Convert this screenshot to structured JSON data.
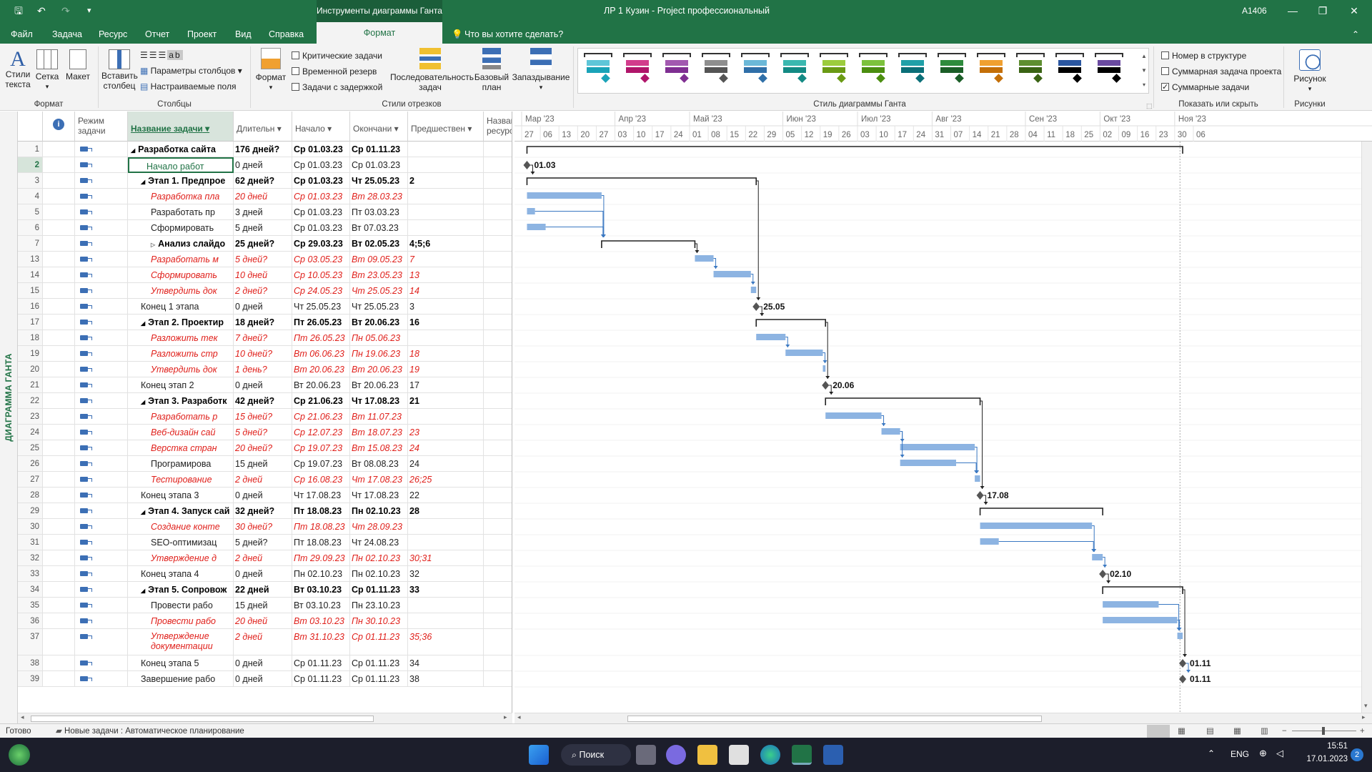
{
  "window": {
    "tools_tab": "Инструменты диаграммы Ганта",
    "title": "ЛР 1 Кузин  -  Project профессиональный",
    "user": "A1406"
  },
  "tabs": [
    {
      "id": "file",
      "label": "Файл"
    },
    {
      "id": "task",
      "label": "Задача"
    },
    {
      "id": "resource",
      "label": "Ресурс"
    },
    {
      "id": "report",
      "label": "Отчет"
    },
    {
      "id": "project",
      "label": "Проект"
    },
    {
      "id": "view",
      "label": "Вид"
    },
    {
      "id": "help",
      "label": "Справка"
    },
    {
      "id": "format",
      "label": "Формат"
    }
  ],
  "search_label": "Что вы хотите сделать?",
  "ribbon": {
    "text_styles": "Стили\nтекста",
    "gridlines": "Сетка",
    "layout": "Макет",
    "group_format": "Формат",
    "insert_column": "Вставить\nстолбец",
    "column_settings": "Параметры столбцов",
    "custom_fields": "Настраиваемые поля",
    "group_columns": "Столбцы",
    "format_btn": "Формат",
    "critical_tasks": "Критические задачи",
    "slack": "Временной резерв",
    "late_tasks": "Задачи с задержкой",
    "task_path": "Последовательность\nзадач",
    "baseline": "Базовый\nплан",
    "slippage": "Запаздывание",
    "group_bar_styles": "Стили отрезков",
    "group_gantt_style": "Стиль диаграммы Ганта",
    "outline_number": "Номер в структуре",
    "project_summary": "Суммарная задача проекта",
    "summary_tasks": "Суммарные задачи",
    "group_show_hide": "Показать или скрыть",
    "drawing": "Рисунок",
    "group_drawings": "Рисунки"
  },
  "gantt_styles": [
    {
      "c": "#5ec6d8",
      "k": "#1aa3b8"
    },
    {
      "c": "#d23c8c",
      "k": "#b0156a"
    },
    {
      "c": "#a259b0",
      "k": "#7f2f92"
    },
    {
      "c": "#8e8e8e",
      "k": "#555555"
    },
    {
      "c": "#6bb8d8",
      "k": "#2f6fa8"
    },
    {
      "c": "#3ab8b0",
      "k": "#138a84"
    },
    {
      "c": "#9ccc3c",
      "k": "#6a9a14"
    },
    {
      "c": "#7cc23c",
      "k": "#4b8e10"
    },
    {
      "c": "#1fa0a8",
      "k": "#0b6f78"
    },
    {
      "c": "#2e8b3c",
      "k": "#1b5e27"
    },
    {
      "c": "#f0a030",
      "k": "#c46f08"
    },
    {
      "c": "#5e8e30",
      "k": "#3a6314"
    },
    {
      "c": "#2a56a0",
      "k": "#000000"
    },
    {
      "c": "#6a4aa0",
      "k": "#000000"
    }
  ],
  "side_label": "ДИАГРАММА ГАНТА",
  "columns": {
    "mode": "Режим\nзадачи",
    "name": "Название задачи",
    "duration": "Длительн",
    "start": "Начало",
    "finish": "Окончани",
    "pred": "Предшествен",
    "res": "Названия\nресурсов"
  },
  "rows": [
    {
      "id": "1",
      "name": "Разработка сайта",
      "dur": "176 дней?",
      "start": "Ср 01.03.23",
      "fin": "Ср 01.11.23",
      "pred": "",
      "t": "sum0",
      "indent": 0
    },
    {
      "id": "2",
      "name": "Начало работ",
      "dur": "0 дней",
      "start": "Ср 01.03.23",
      "fin": "Ср 01.03.23",
      "pred": "",
      "t": "sel",
      "indent": 1
    },
    {
      "id": "3",
      "name": "Этап 1. Предпрое",
      "dur": "62 дней?",
      "start": "Ср 01.03.23",
      "fin": "Чт 25.05.23",
      "pred": "2",
      "t": "sum",
      "indent": 1
    },
    {
      "id": "4",
      "name": "Разработка пла",
      "dur": "20 дней",
      "start": "Ср 01.03.23",
      "fin": "Вт 28.03.23",
      "pred": "",
      "t": "crit",
      "indent": 2
    },
    {
      "id": "5",
      "name": "Разработать пр",
      "dur": "3 дней",
      "start": "Ср 01.03.23",
      "fin": "Пт 03.03.23",
      "pred": "",
      "t": "n",
      "indent": 2
    },
    {
      "id": "6",
      "name": "Сформировать",
      "dur": "5 дней",
      "start": "Ср 01.03.23",
      "fin": "Вт 07.03.23",
      "pred": "",
      "t": "n",
      "indent": 2
    },
    {
      "id": "7",
      "name": "Анализ слайдо",
      "dur": "25 дней?",
      "start": "Ср 29.03.23",
      "fin": "Вт 02.05.23",
      "pred": "4;5;6",
      "t": "sumc",
      "indent": 2
    },
    {
      "id": "13",
      "name": "Разработать м",
      "dur": "5 дней?",
      "start": "Ср 03.05.23",
      "fin": "Вт 09.05.23",
      "pred": "7",
      "t": "crit",
      "indent": 2
    },
    {
      "id": "14",
      "name": "Сформировать",
      "dur": "10 дней",
      "start": "Ср 10.05.23",
      "fin": "Вт 23.05.23",
      "pred": "13",
      "t": "crit",
      "indent": 2
    },
    {
      "id": "15",
      "name": "Утвердить док",
      "dur": "2 дней?",
      "start": "Ср 24.05.23",
      "fin": "Чт 25.05.23",
      "pred": "14",
      "t": "crit",
      "indent": 2
    },
    {
      "id": "16",
      "name": "Конец 1 этапа",
      "dur": "0 дней",
      "start": "Чт 25.05.23",
      "fin": "Чт 25.05.23",
      "pred": "3",
      "t": "n",
      "indent": 1
    },
    {
      "id": "17",
      "name": "Этап 2. Проектир",
      "dur": "18 дней?",
      "start": "Пт 26.05.23",
      "fin": "Вт 20.06.23",
      "pred": "16",
      "t": "sum",
      "indent": 1
    },
    {
      "id": "18",
      "name": "Разложить тек",
      "dur": "7 дней?",
      "start": "Пт 26.05.23",
      "fin": "Пн 05.06.23",
      "pred": "",
      "t": "crit",
      "indent": 2
    },
    {
      "id": "19",
      "name": "Разложить стр",
      "dur": "10 дней?",
      "start": "Вт 06.06.23",
      "fin": "Пн 19.06.23",
      "pred": "18",
      "t": "crit",
      "indent": 2
    },
    {
      "id": "20",
      "name": "Утвердить док",
      "dur": "1 день?",
      "start": "Вт 20.06.23",
      "fin": "Вт 20.06.23",
      "pred": "19",
      "t": "crit",
      "indent": 2
    },
    {
      "id": "21",
      "name": "Конец этап 2",
      "dur": "0 дней",
      "start": "Вт 20.06.23",
      "fin": "Вт 20.06.23",
      "pred": "17",
      "t": "n",
      "indent": 1
    },
    {
      "id": "22",
      "name": "Этап 3. Разработк",
      "dur": "42 дней?",
      "start": "Ср 21.06.23",
      "fin": "Чт 17.08.23",
      "pred": "21",
      "t": "sum",
      "indent": 1
    },
    {
      "id": "23",
      "name": "Разработать р",
      "dur": "15 дней?",
      "start": "Ср 21.06.23",
      "fin": "Вт 11.07.23",
      "pred": "",
      "t": "crit",
      "indent": 2
    },
    {
      "id": "24",
      "name": "Веб-дизайн сай",
      "dur": "5 дней?",
      "start": "Ср 12.07.23",
      "fin": "Вт 18.07.23",
      "pred": "23",
      "t": "crit",
      "indent": 2
    },
    {
      "id": "25",
      "name": "Верстка стран",
      "dur": "20 дней?",
      "start": "Ср 19.07.23",
      "fin": "Вт 15.08.23",
      "pred": "24",
      "t": "crit",
      "indent": 2
    },
    {
      "id": "26",
      "name": "Програмирова",
      "dur": "15 дней",
      "start": "Ср 19.07.23",
      "fin": "Вт 08.08.23",
      "pred": "24",
      "t": "n",
      "indent": 2
    },
    {
      "id": "27",
      "name": "Тестирование",
      "dur": "2 дней",
      "start": "Ср 16.08.23",
      "fin": "Чт 17.08.23",
      "pred": "26;25",
      "t": "crit",
      "indent": 2
    },
    {
      "id": "28",
      "name": "Конец этапа 3",
      "dur": "0 дней",
      "start": "Чт 17.08.23",
      "fin": "Чт 17.08.23",
      "pred": "22",
      "t": "n",
      "indent": 1
    },
    {
      "id": "29",
      "name": "Этап 4. Запуск сай",
      "dur": "32 дней?",
      "start": "Пт 18.08.23",
      "fin": "Пн 02.10.23",
      "pred": "28",
      "t": "sum",
      "indent": 1
    },
    {
      "id": "30",
      "name": "Создание конте",
      "dur": "30 дней?",
      "start": "Пт 18.08.23",
      "fin": "Чт 28.09.23",
      "pred": "",
      "t": "crit",
      "indent": 2
    },
    {
      "id": "31",
      "name": "SEO-оптимизац",
      "dur": "5 дней?",
      "start": "Пт 18.08.23",
      "fin": "Чт 24.08.23",
      "pred": "",
      "t": "n",
      "indent": 2
    },
    {
      "id": "32",
      "name": "Утверждение д",
      "dur": "2 дней",
      "start": "Пт 29.09.23",
      "fin": "Пн 02.10.23",
      "pred": "30;31",
      "t": "crit",
      "indent": 2
    },
    {
      "id": "33",
      "name": "Конец этапа 4",
      "dur": "0 дней",
      "start": "Пн 02.10.23",
      "fin": "Пн 02.10.23",
      "pred": "32",
      "t": "n",
      "indent": 1
    },
    {
      "id": "34",
      "name": "Этап 5. Сопровож",
      "dur": "22 дней",
      "start": "Вт 03.10.23",
      "fin": "Ср 01.11.23",
      "pred": "33",
      "t": "sum",
      "indent": 1
    },
    {
      "id": "35",
      "name": "Провести рабо",
      "dur": "15 дней",
      "start": "Вт 03.10.23",
      "fin": "Пн 23.10.23",
      "pred": "",
      "t": "n",
      "indent": 2
    },
    {
      "id": "36",
      "name": "Провести рабо",
      "dur": "20 дней",
      "start": "Вт 03.10.23",
      "fin": "Пн 30.10.23",
      "pred": "",
      "t": "crit",
      "indent": 2
    },
    {
      "id": "37",
      "name": "Утверждение\nдокументации",
      "dur": "2 дней",
      "start": "Вт 31.10.23",
      "fin": "Ср 01.11.23",
      "pred": "35;36",
      "t": "crit",
      "indent": 2,
      "tall": true
    },
    {
      "id": "38",
      "name": "Конец этапа 5",
      "dur": "0 дней",
      "start": "Ср 01.11.23",
      "fin": "Ср 01.11.23",
      "pred": "34",
      "t": "n",
      "indent": 1
    },
    {
      "id": "39",
      "name": "Завершение рабо",
      "dur": "0 дней",
      "start": "Ср 01.11.23",
      "fin": "Ср 01.11.23",
      "pred": "38",
      "t": "n",
      "indent": 1
    }
  ],
  "timescale": {
    "months": [
      {
        "label": "Мар '23",
        "start": "2023-02-27"
      },
      {
        "label": "Апр '23",
        "start": "2023-04-03"
      },
      {
        "label": "Май '23",
        "start": "2023-05-01"
      },
      {
        "label": "Июн '23",
        "start": "2023-06-05"
      },
      {
        "label": "Июл '23",
        "start": "2023-07-03"
      },
      {
        "label": "Авг '23",
        "start": "2023-07-31"
      },
      {
        "label": "Сен '23",
        "start": "2023-09-04"
      },
      {
        "label": "Окт '23",
        "start": "2023-10-02"
      },
      {
        "label": "Ноя '23",
        "start": "2023-10-30"
      }
    ],
    "days": [
      "27",
      "06",
      "13",
      "20",
      "27",
      "03",
      "10",
      "17",
      "24",
      "01",
      "08",
      "15",
      "22",
      "29",
      "05",
      "12",
      "19",
      "26",
      "03",
      "10",
      "17",
      "24",
      "31",
      "07",
      "14",
      "21",
      "28",
      "04",
      "11",
      "18",
      "25",
      "02",
      "09",
      "16",
      "23",
      "30",
      "06"
    ]
  },
  "gantt": {
    "milestone_labels": [
      {
        "row": 1,
        "date": "2023-03-01",
        "label": "01.03"
      },
      {
        "row": 10,
        "date": "2023-05-25",
        "label": "25.05"
      },
      {
        "row": 15,
        "date": "2023-06-20",
        "label": "20.06"
      },
      {
        "row": 22,
        "date": "2023-08-17",
        "label": "17.08"
      },
      {
        "row": 27,
        "date": "2023-10-02",
        "label": "02.10"
      },
      {
        "row": 32,
        "date": "2023-11-01",
        "label": "01.11"
      },
      {
        "row": 33,
        "date": "2023-11-01",
        "label": "01.11"
      }
    ]
  },
  "status": {
    "ready": "Готово",
    "new_tasks": "Новые задачи : Автоматическое планирование"
  },
  "taskbar": {
    "search": "Поиск",
    "lang": "ENG",
    "time": "15:51",
    "date": "17.01.2023",
    "notif": "2"
  }
}
